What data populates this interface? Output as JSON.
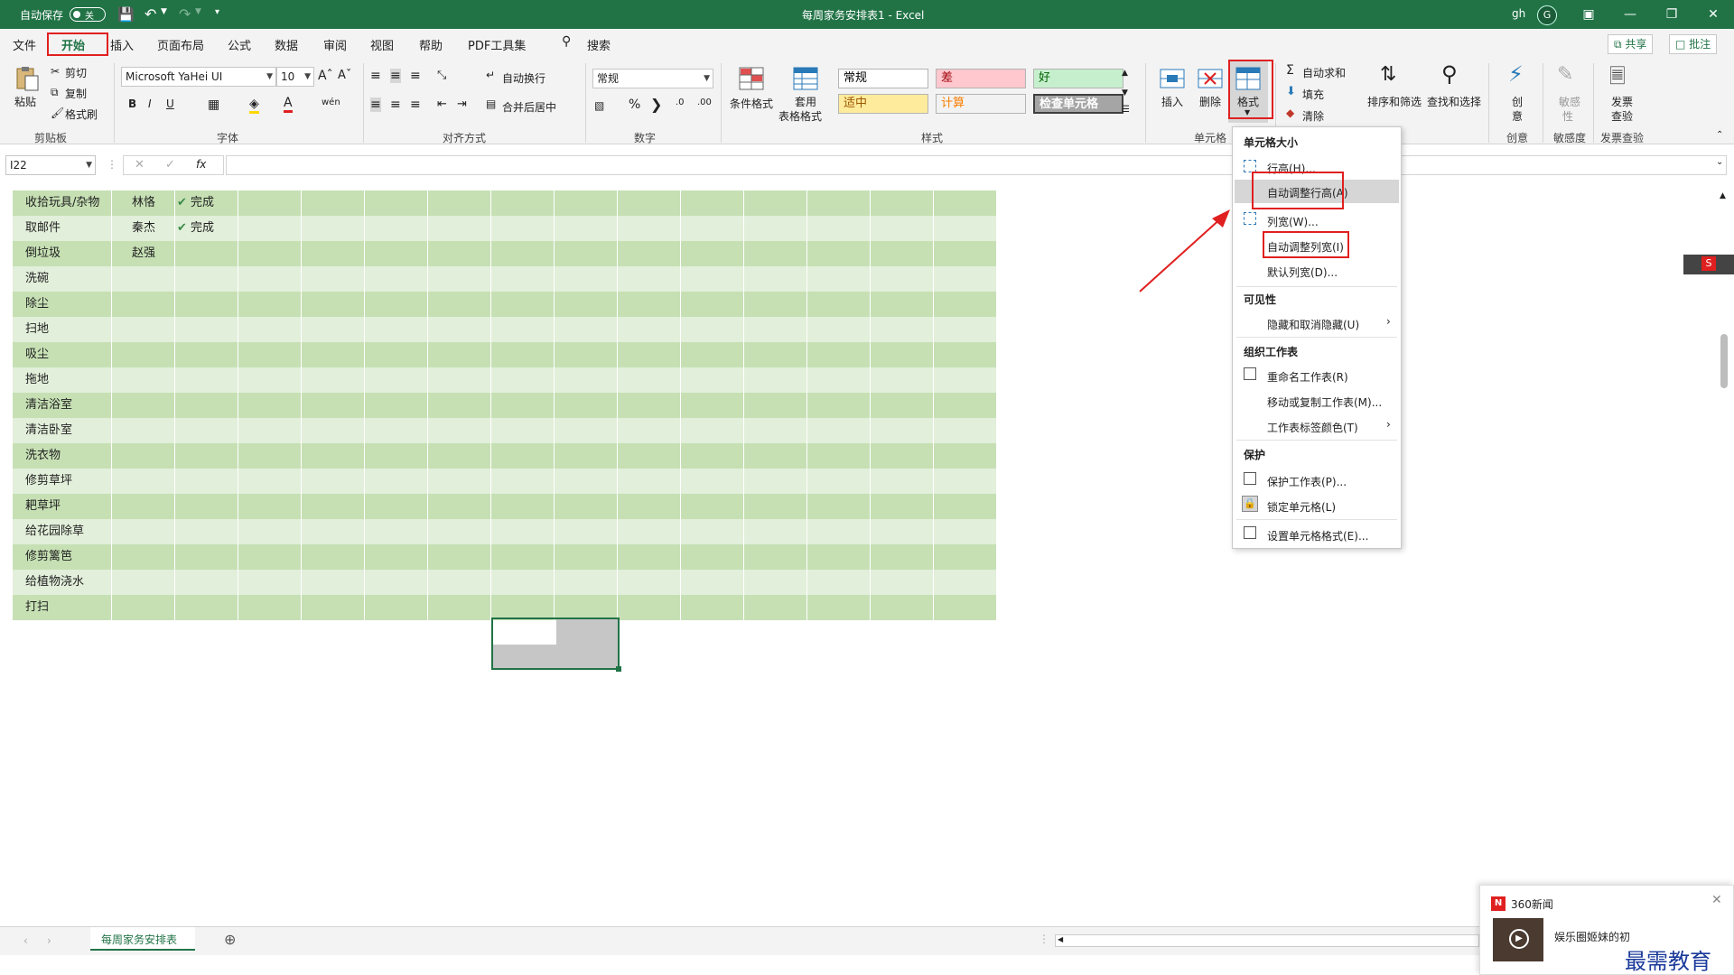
{
  "titlebar": {
    "autosave_label": "自动保存",
    "autosave_state": "关",
    "title": "每周家务安排表1 - Excel",
    "user": "gh",
    "avatar": "G"
  },
  "tabs": [
    "文件",
    "开始",
    "插入",
    "页面布局",
    "公式",
    "数据",
    "审阅",
    "视图",
    "帮助",
    "PDF工具集"
  ],
  "search_label": "搜索",
  "share_label": "共享",
  "comment_label": "批注",
  "ribbon": {
    "clipboard": {
      "paste": "粘贴",
      "cut": "剪切",
      "copy": "复制",
      "format_painter": "格式刷",
      "label": "剪贴板"
    },
    "font": {
      "name": "Microsoft YaHei UI",
      "size": "10",
      "label": "字体"
    },
    "alignment": {
      "wrap": "自动换行",
      "merge": "合并后居中",
      "label": "对齐方式"
    },
    "number": {
      "format": "常规",
      "label": "数字"
    },
    "styles": {
      "cond_format": "条件格式",
      "table_format_1": "套用",
      "table_format_2": "表格格式",
      "cells": [
        {
          "text": "常规",
          "bg": "#ffffff",
          "fg": "#000000"
        },
        {
          "text": "差",
          "bg": "#ffc7ce",
          "fg": "#9c0006"
        },
        {
          "text": "好",
          "bg": "#c6efce",
          "fg": "#006100"
        },
        {
          "text": "适中",
          "bg": "#ffeb9c",
          "fg": "#9c5700"
        },
        {
          "text": "计算",
          "bg": "#f2f2f2",
          "fg": "#fa7d00"
        },
        {
          "text": "检查单元格",
          "bg": "#a5a5a5",
          "fg": "#ffffff"
        }
      ],
      "label": "样式"
    },
    "cells": {
      "insert": "插入",
      "delete": "删除",
      "format": "格式",
      "label": "单元格"
    },
    "editing": {
      "autosum": "自动求和",
      "fill": "填充",
      "clear": "清除",
      "sort": "排序和筛选",
      "find": "查找和选择"
    },
    "creative": {
      "btn1": "创",
      "btn2": "意",
      "label": "创意"
    },
    "sensitivity": {
      "btn1": "敏感",
      "btn2": "性",
      "label": "敏感度"
    },
    "invoice": {
      "btn1": "发票",
      "btn2": "查验",
      "label": "发票查验"
    }
  },
  "formula_bar": {
    "namebox": "I22",
    "fx": "fx",
    "value": ""
  },
  "grid": {
    "rows": [
      {
        "task": "收拾玩具/杂物",
        "person": "林恪",
        "status": "完成"
      },
      {
        "task": "取邮件",
        "person": "秦杰",
        "status": "完成"
      },
      {
        "task": "倒垃圾",
        "person": "赵强",
        "status": ""
      },
      {
        "task": "洗碗",
        "person": "",
        "status": ""
      },
      {
        "task": "除尘",
        "person": "",
        "status": ""
      },
      {
        "task": "扫地",
        "person": "",
        "status": ""
      },
      {
        "task": "吸尘",
        "person": "",
        "status": ""
      },
      {
        "task": "拖地",
        "person": "",
        "status": ""
      },
      {
        "task": "清洁浴室",
        "person": "",
        "status": ""
      },
      {
        "task": "清洁卧室",
        "person": "",
        "status": ""
      },
      {
        "task": "洗衣物",
        "person": "",
        "status": ""
      },
      {
        "task": "修剪草坪",
        "person": "",
        "status": ""
      },
      {
        "task": "耙草坪",
        "person": "",
        "status": ""
      },
      {
        "task": "给花园除草",
        "person": "",
        "status": ""
      },
      {
        "task": "修剪篱笆",
        "person": "",
        "status": ""
      },
      {
        "task": "给植物浇水",
        "person": "",
        "status": ""
      },
      {
        "task": "打扫",
        "person": "",
        "status": ""
      }
    ]
  },
  "menu": {
    "h_size": "单元格大小",
    "row_height": "行高(H)...",
    "autofit_row": "自动调整行高(A)",
    "col_width": "列宽(W)...",
    "autofit_col": "自动调整列宽(I)",
    "default_width": "默认列宽(D)...",
    "h_visibility": "可见性",
    "hide_unhide": "隐藏和取消隐藏(U)",
    "h_organize": "组织工作表",
    "rename": "重命名工作表(R)",
    "move_copy": "移动或复制工作表(M)...",
    "tab_color": "工作表标签颜色(T)",
    "h_protect": "保护",
    "protect_sheet": "保护工作表(P)...",
    "lock_cell": "锁定单元格(L)",
    "format_cells": "设置单元格格式(E)..."
  },
  "sheet_tab": "每周家务安排表",
  "news": {
    "source": "360新闻",
    "text": "娱乐圈姬妹的初",
    "watermark": "最需教育"
  },
  "colors": {
    "excel_green": "#217346",
    "row_dark": "#c6e0b4",
    "row_light": "#e2efda",
    "highlight": "#e02020"
  }
}
